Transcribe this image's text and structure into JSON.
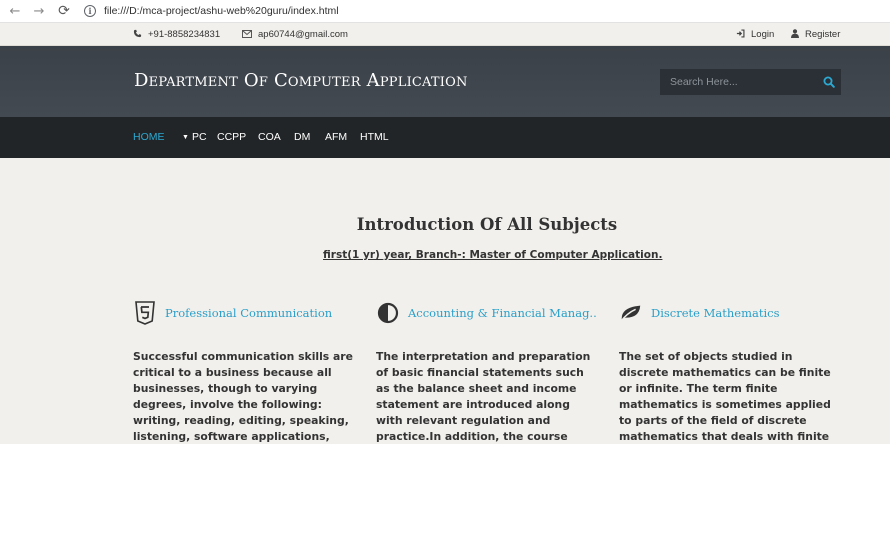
{
  "browser": {
    "url": "file:///D:/mca-project/ashu-web%20guru/index.html",
    "back_icon": "←",
    "forward_icon": "→",
    "reload_icon": "⟳",
    "info_icon": "i"
  },
  "topbar": {
    "phone": "+91-8858234831",
    "email": "ap60744@gmail.com",
    "login": "Login",
    "register": "Register"
  },
  "header": {
    "title": "Department Of Computer Application",
    "search_placeholder": "Search Here..."
  },
  "nav": {
    "items": [
      "HOME",
      "PC",
      "CCPP",
      "COA",
      "DM",
      "AFM",
      "HTML"
    ]
  },
  "intro": {
    "title": "Introduction Of All Subjects",
    "subtitle": "first(1 yr) year, Branch-: Master of Computer Application."
  },
  "subjects": [
    {
      "title": "Professional Communication",
      "icon": "html5-icon",
      "text": "Successful communication skills are critical to a business because all businesses, though to varying degrees, involve the following: writing, reading, editing, speaking, listening, software applications,"
    },
    {
      "title": "Accounting & Financial Manag..",
      "icon": "adjust-icon",
      "text": "The interpretation and preparation of basic financial statements such as the balance sheet and income statement are introduced along with relevant regulation and practice.In addition, the course introduces the student to"
    },
    {
      "title": "Discrete Mathematics",
      "icon": "leaf-icon",
      "text": "The set of objects studied in discrete mathematics can be finite or infinite. The term finite mathematics is sometimes applied to parts of the field of discrete mathematics that deals with finite sets, particularly those"
    }
  ],
  "colors": {
    "accent": "#2ca9d2",
    "header_bg": "#3f454c",
    "nav_bg": "#222527",
    "page_bg": "#f2f0ec"
  }
}
